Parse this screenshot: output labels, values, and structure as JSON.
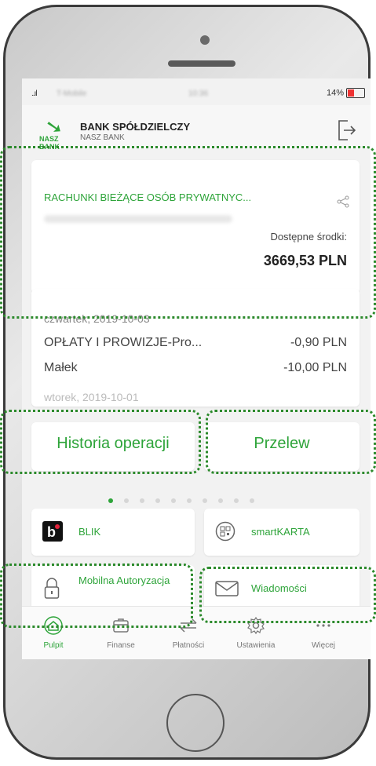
{
  "status": {
    "signal": "..ıl",
    "carrier": "T-Mobile",
    "time": "10:36",
    "battery": "14%"
  },
  "header": {
    "logo_text": "NASZ BANK",
    "bank_name": "BANK SPÓŁDZIELCZY",
    "bank_sub": "NASZ BANK",
    "logout_icon": "logout-icon"
  },
  "account": {
    "title": "RACHUNKI BIEŻĄCE OSÓB PRYWATNYC...",
    "available_label": "Dostępne środki:",
    "available_value": "3669,53 PLN"
  },
  "history": {
    "date1": "czwartek, 2019-10-03",
    "rows": [
      {
        "name": "OPŁATY I PROWIZJE-Pro...",
        "amount": "-0,90 PLN"
      },
      {
        "name": "Małek",
        "amount": "-10,00 PLN"
      }
    ],
    "date2": "wtorek, 2019-10-01"
  },
  "buttons": {
    "history": "Historia operacji",
    "transfer": "Przelew"
  },
  "tiles": {
    "blik": "BLIK",
    "smartkarta": "smartKARTA",
    "mobile_auth": "Mobilna Autoryzacja",
    "messages": "Wiadomości"
  },
  "tabs": [
    "Pulpit",
    "Finanse",
    "Płatności",
    "Ustawienia",
    "Więcej"
  ],
  "colors": {
    "accent": "#2ea43a",
    "highlight": "#2c8a2c"
  }
}
